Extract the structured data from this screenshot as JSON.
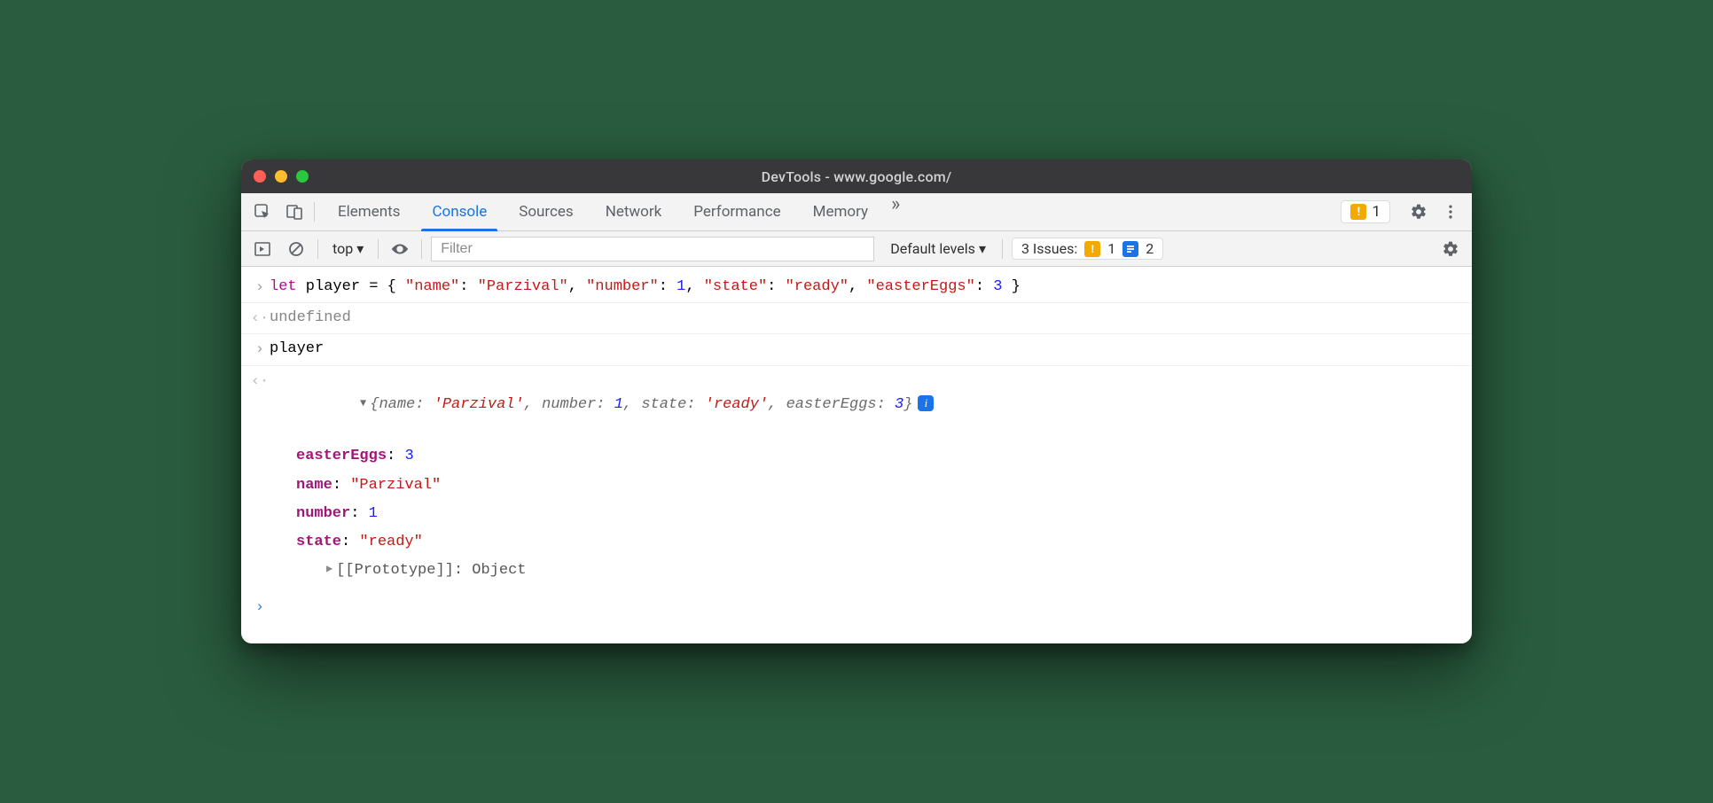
{
  "window": {
    "title": "DevTools - www.google.com/"
  },
  "tabs": {
    "items": [
      "Elements",
      "Console",
      "Sources",
      "Network",
      "Performance",
      "Memory"
    ],
    "active_index": 1
  },
  "tabbar_right": {
    "warn_count": "1"
  },
  "console_toolbar": {
    "context": "top",
    "filter_placeholder": "Filter",
    "levels_label": "Default levels",
    "issues_label": "3 Issues:",
    "issues_warn_count": "1",
    "issues_info_count": "2"
  },
  "console": {
    "input1": {
      "keyword": "let",
      "var": " player = { ",
      "k1": "\"name\"",
      "s1": "\"Parzival\"",
      "k2": "\"number\"",
      "n1": "1",
      "k3": "\"state\"",
      "s2": "\"ready\"",
      "k4": "\"easterEggs\"",
      "n2": "3",
      "tail": " }"
    },
    "output1": "undefined",
    "input2": "player",
    "summary": {
      "open": "{",
      "k1": "name:",
      "v1": "'Parzival'",
      "k2": "number:",
      "n1": "1",
      "k3": "state:",
      "v2": "'ready'",
      "k4": "easterEggs:",
      "n2": "3",
      "close": "}"
    },
    "props": [
      {
        "k": "easterEggs",
        "v": "3",
        "type": "num"
      },
      {
        "k": "name",
        "v": "\"Parzival\"",
        "type": "str"
      },
      {
        "k": "number",
        "v": "1",
        "type": "num"
      },
      {
        "k": "state",
        "v": "\"ready\"",
        "type": "str"
      }
    ],
    "proto": {
      "label": "[[Prototype]]",
      "value": "Object"
    }
  }
}
